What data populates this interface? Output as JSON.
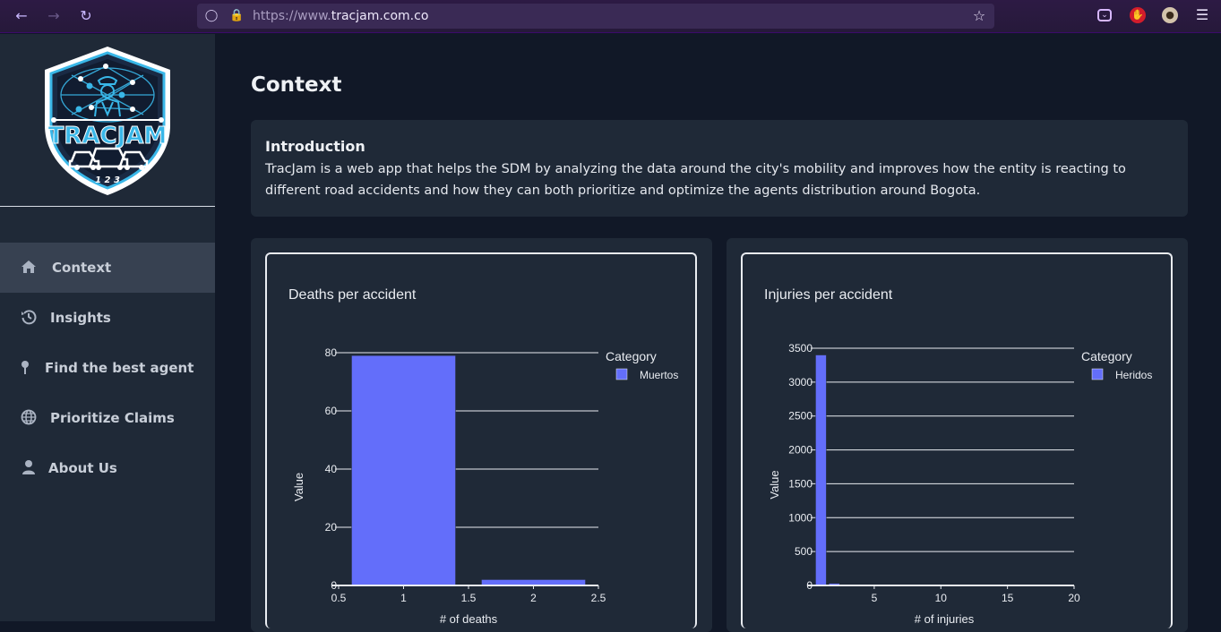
{
  "browser": {
    "url_prefix": "https://www.",
    "url_domain": "tracjam.com.co",
    "back_icon": "arrow-left-icon",
    "forward_icon": "arrow-right-icon",
    "reload_icon": "reload-icon"
  },
  "logo": {
    "name": "TRACJAM",
    "numbers": "1  2  3"
  },
  "sidebar": {
    "items": [
      {
        "label": "Context",
        "icon": "home-icon",
        "active": true
      },
      {
        "label": "Insights",
        "icon": "history-icon",
        "active": false
      },
      {
        "label": "Find the best agent",
        "icon": "map-pin-icon",
        "active": false
      },
      {
        "label": "Prioritize Claims",
        "icon": "globe-icon",
        "active": false
      },
      {
        "label": "About Us",
        "icon": "user-icon",
        "active": false
      }
    ]
  },
  "main": {
    "title": "Context",
    "intro": {
      "heading": "Introduction",
      "body": "TracJam is a web app that helps the SDM by analyzing the data around the city's mobility and improves how the entity is reacting to different road accidents and how they can both prioritize and optimize the agents distribution around Bogota."
    }
  },
  "colors": {
    "bar": "#636efa",
    "sidebar_bg": "#1f2937",
    "main_bg": "#111827",
    "active_item_bg": "#374151"
  },
  "chart_data": [
    {
      "type": "bar",
      "title": "Deaths per accident",
      "xlabel": "# of deaths",
      "ylabel": "Value",
      "legend_title": "Category",
      "series": [
        {
          "name": "Muertos",
          "x": [
            1,
            2
          ],
          "values": [
            79,
            2
          ]
        }
      ],
      "xlim": [
        0.5,
        2.5
      ],
      "ylim": [
        0,
        80
      ],
      "xticks": [
        "0.5",
        "1",
        "1.5",
        "2",
        "2.5"
      ],
      "yticks": [
        "0",
        "20",
        "40",
        "60",
        "80"
      ],
      "legend_position": "top-right",
      "grid": true
    },
    {
      "type": "bar",
      "title": "Injuries per accident",
      "xlabel": "# of injuries",
      "ylabel": "Value",
      "legend_title": "Category",
      "series": [
        {
          "name": "Heridos",
          "x": [
            1,
            2
          ],
          "values": [
            3400,
            30
          ]
        }
      ],
      "xlim": [
        0.5,
        20
      ],
      "ylim": [
        0,
        3500
      ],
      "xticks": [
        "5",
        "10",
        "15",
        "20"
      ],
      "yticks": [
        "0",
        "500",
        "1000",
        "1500",
        "2000",
        "2500",
        "3000",
        "3500"
      ],
      "legend_position": "top-right",
      "grid": true
    }
  ]
}
